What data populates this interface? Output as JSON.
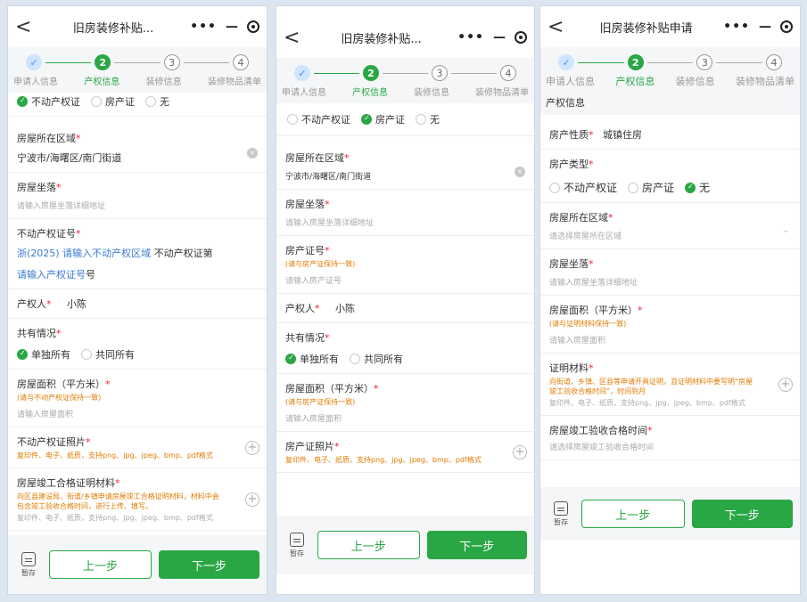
{
  "panels": [
    {
      "title": "旧房装修补贴...",
      "steps": [
        "申请人信息",
        "产权信息",
        "装修信息",
        "装修物品清单"
      ],
      "step_nums": [
        "✓",
        "2",
        "3",
        "4"
      ],
      "radio_opts": [
        "不动产权证",
        "房产证",
        "无"
      ],
      "area_label": "房屋所在区域",
      "area_value": "宁波市/海曙区/南门街道",
      "loc_label": "房屋坐落",
      "loc_ph": "请输入房屋坐落详细地址",
      "cert_label": "不动产权证号",
      "cert_prefix": "浙(2025)",
      "cert_region": "请输入不动产权区域",
      "cert_mid": "不动产权证第",
      "cert_num": "请输入产权证号",
      "cert_suffix": "号",
      "owner_label": "产权人",
      "owner_value": "小陈",
      "share_label": "共有情况",
      "share_opts": [
        "单独所有",
        "共同所有"
      ],
      "area2_label": "房屋面积（平方米）",
      "area2_hint": "(请与不动产权证保持一致)",
      "area2_ph": "请输入房屋面积",
      "photo_label": "不动产权证照片",
      "photo_hint": "复印件、电子、纸质，支持png、jpg、jpeg、bmp、pdf格式",
      "completion_label": "房屋竣工合格证明材料",
      "completion_hint": "向区县建设局、街道/乡镇申请房屋竣工合格证明材料，材料中会包含竣工验收合格时间，进行上传、填写。",
      "completion_formats": "复印件、电子、纸质，支持png、jpg、jpeg、bmp、pdf格式",
      "save": "暂存",
      "prev": "上一步",
      "next": "下一步"
    },
    {
      "title": "旧房装修补贴...",
      "steps": [
        "申请人信息",
        "产权信息",
        "装修信息",
        "装修物品清单"
      ],
      "step_nums": [
        "✓",
        "2",
        "3",
        "4"
      ],
      "radio_opts": [
        "不动产权证",
        "房产证",
        "无"
      ],
      "area_label": "房屋所在区域",
      "area_value": "宁波市/海曙区/南门街道",
      "loc_label": "房屋坐落",
      "loc_ph": "请输入房屋坐落详细地址",
      "cert_label": "房产证号",
      "cert_hint": "(请与房产证保持一致)",
      "cert_ph": "请输入房产证号",
      "owner_label": "产权人",
      "owner_value": "小陈",
      "share_label": "共有情况",
      "share_opts": [
        "单独所有",
        "共同所有"
      ],
      "area2_label": "房屋面积（平方米）",
      "area2_hint": "(请与房产证保持一致)",
      "area2_ph": "请输入房屋面积",
      "photo_label": "房产证照片",
      "photo_hint": "复印件、电子、纸质，支持png、jpg、jpeg、bmp、pdf格式",
      "save": "暂存",
      "prev": "上一步",
      "next": "下一步"
    },
    {
      "title": "旧房装修补贴申请",
      "steps": [
        "申请人信息",
        "产权信息",
        "装修信息",
        "装修物品清单"
      ],
      "step_nums": [
        "✓",
        "2",
        "3",
        "4"
      ],
      "section": "产权信息",
      "nature_label": "房产性质",
      "nature_value": "城镇住房",
      "type_label": "房产类型",
      "radio_opts": [
        "不动产权证",
        "房产证",
        "无"
      ],
      "area_label": "房屋所在区域",
      "area_ph": "请选择房屋所在区域",
      "loc_label": "房屋坐落",
      "loc_ph": "请输入房屋坐落详细地址",
      "area2_label": "房屋面积（平方米）",
      "area2_hint": "(请与证明材料保持一致)",
      "area2_ph": "请输入房屋面积",
      "proof_label": "证明材料",
      "proof_hint": "向街道、乡镇、区县等申请开具证明，且证明材料中要写明“房屋竣工验收合格时间”，时间到月",
      "proof_formats": "复印件、电子、纸质，支持png、jpg、jpeg、bmp、pdf格式",
      "date_label": "房屋竣工验收合格时间",
      "date_ph": "请选择房屋竣工验收合格时间",
      "save": "暂存",
      "prev": "上一步",
      "next": "下一步"
    }
  ]
}
